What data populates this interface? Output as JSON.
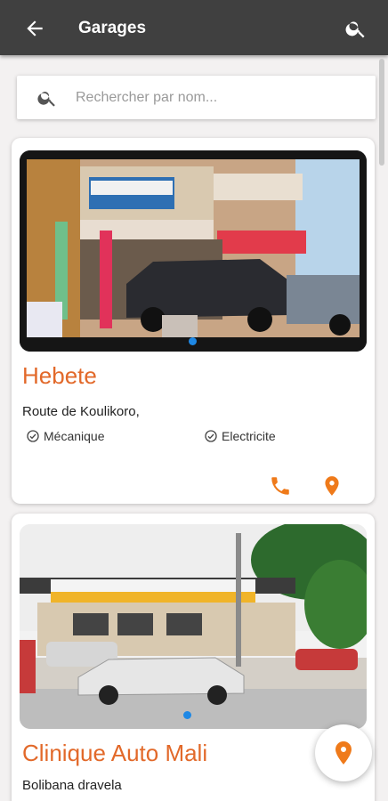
{
  "appbar": {
    "title": "Garages",
    "back_icon": "arrow-left-icon",
    "search_icon": "search-icon"
  },
  "search": {
    "placeholder": "Rechercher par nom...",
    "value": "",
    "icon": "search-icon"
  },
  "colors": {
    "appbar": "#404040",
    "accent": "#e2692a",
    "dot": "#1e88e5",
    "background": "#f3f1f1"
  },
  "garages": [
    {
      "name": "Hebete",
      "address": "Route de Koulikoro,",
      "services": [
        "Mécanique",
        "Electricite"
      ],
      "actions": {
        "call_icon": "phone-icon",
        "location_icon": "location-pin-icon"
      },
      "photo": {
        "description_icon": "garage-photo",
        "carousel_position": 1
      }
    },
    {
      "name": "Clinique Auto Mali",
      "address": "Bolibana dravela",
      "photo": {
        "description_icon": "garage-photo",
        "carousel_position": 1
      }
    }
  ],
  "fab": {
    "icon": "location-pin-icon"
  }
}
